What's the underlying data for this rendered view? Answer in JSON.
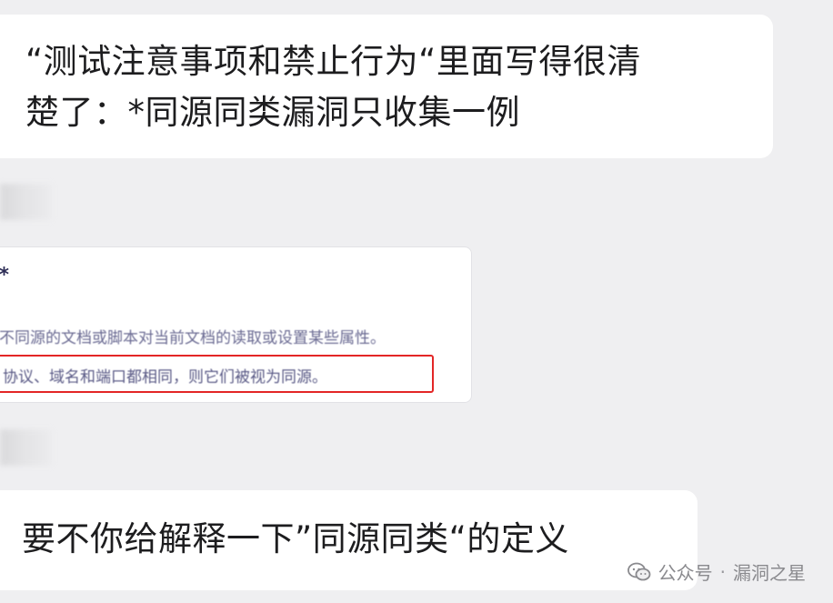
{
  "messages": {
    "msg1": {
      "line1": "“测试注意事项和禁止行为“里面写得很清",
      "line2": "楚了：*同源同类漏洞只收集一例"
    },
    "card": {
      "title": "*",
      "line1": "不同源的文档或脚本对当前文档的读取或设置某些属性。",
      "line2": "协议、域名和端口都相同，则它们被视为同源。"
    },
    "msg2": {
      "line1": "要不你给解释一下”同源同类“的定义"
    }
  },
  "watermark": {
    "source": "公众号",
    "separator": "·",
    "account": "漏洞之星",
    "icon": "wechat-icon"
  },
  "colors": {
    "background": "#efeff1",
    "bubble": "#ffffff",
    "highlight": "#e32626"
  }
}
